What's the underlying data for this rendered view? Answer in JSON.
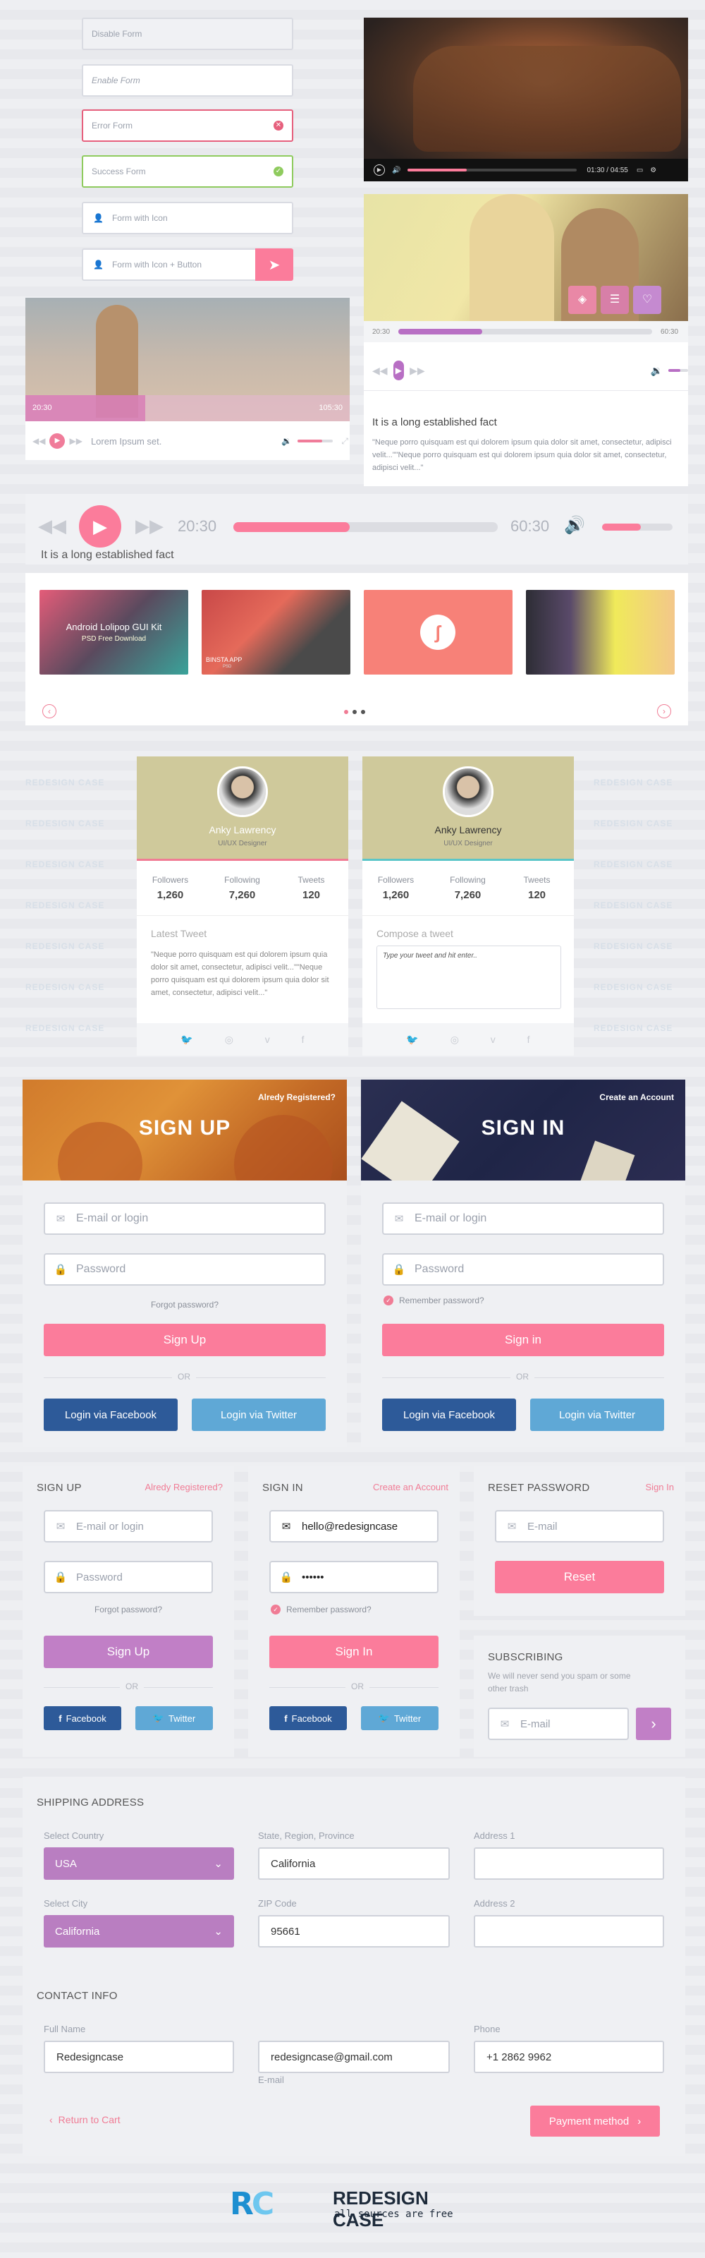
{
  "forms": {
    "disable": "Disable Form",
    "enable": "Enable Form",
    "error": "Error Form",
    "success": "Success Form",
    "with_icon": "Form with Icon",
    "with_icon_button": "Form with Icon + Button"
  },
  "video_player": {
    "time": "01:30 / 04:55"
  },
  "photo_player": {
    "current": "20:30",
    "total": "60:30",
    "title": "It is a long established fact",
    "text": "\"Neque porro quisquam est qui dolorem ipsum quia dolor sit amet, consectetur, adipisci velit...\"\"Neque porro quisquam est qui dolorem ipsum quia dolor sit amet, consectetur, adipisci velit...\"",
    "progress": 0.33,
    "volume": 0.6
  },
  "girl_player": {
    "current": "20:30",
    "total": "105:30",
    "title": "Lorem Ipsum set.",
    "progress": 0.37,
    "volume": 0.7
  },
  "big_player": {
    "current": "20:30",
    "total": "60:30",
    "title": "It is a long established fact",
    "progress": 0.44,
    "volume": 0.55
  },
  "gallery": {
    "items": [
      {
        "title": "Android Lolipop GUI Kit",
        "sub": "PSD Free Download"
      },
      {
        "title": "BINSTA APP",
        "sub": "PSD"
      },
      {
        "title": "",
        "sub": ""
      },
      {
        "title": "",
        "sub": ""
      }
    ]
  },
  "profiles": [
    {
      "name": "Anky Lawrency",
      "role": "UI/UX Designer",
      "stats": [
        {
          "label": "Followers",
          "value": "1,260"
        },
        {
          "label": "Following",
          "value": "7,260"
        },
        {
          "label": "Tweets",
          "value": "120"
        }
      ],
      "section": "Latest Tweet",
      "text": "\"Neque porro quisquam est qui dolorem ipsum quia dolor sit amet, consectetur, adipisci velit...\"\"Neque porro quisquam est qui dolorem ipsum quia dolor sit amet, consectetur, adipisci velit...\""
    },
    {
      "name": "Anky Lawrency",
      "role": "UI/UX Designer",
      "stats": [
        {
          "label": "Followers",
          "value": "1,260"
        },
        {
          "label": "Following",
          "value": "7,260"
        },
        {
          "label": "Tweets",
          "value": "120"
        }
      ],
      "section": "Compose a tweet",
      "placeholder": "Type your tweet and hit enter.."
    }
  ],
  "watermark": "REDESIGN CASE",
  "signup_big": {
    "title": "SIGN UP",
    "link": "Alredy Registered?",
    "email": "E-mail or login",
    "password": "Password",
    "forgot": "Forgot password?",
    "button": "Sign Up",
    "or": "OR",
    "facebook": "Login via Facebook",
    "twitter": "Login via Twitter"
  },
  "signin_big": {
    "title": "SIGN IN",
    "link": "Create an Account",
    "email": "E-mail or login",
    "password": "Password",
    "remember": "Remember password?",
    "button": "Sign in",
    "or": "OR",
    "facebook": "Login via Facebook",
    "twitter": "Login via Twitter"
  },
  "signup_small": {
    "title": "SIGN UP",
    "link": "Alredy Registered?",
    "email": "E-mail or login",
    "password": "Password",
    "forgot": "Forgot password?",
    "button": "Sign Up",
    "or": "OR",
    "facebook": "Facebook",
    "twitter": "Twitter"
  },
  "signin_small": {
    "title": "SIGN IN",
    "link": "Create an Account",
    "email": "hello@redesigncase",
    "password": "••••••",
    "remember": "Remember password?",
    "button": "Sign In",
    "or": "OR",
    "facebook": "Facebook",
    "twitter": "Twitter"
  },
  "reset": {
    "title": "RESET PASSWORD",
    "link": "Sign In",
    "email": "E-mail",
    "button": "Reset"
  },
  "subscribe": {
    "title": "SUBSCRIBING",
    "text": "We will never send you spam or some other trash",
    "email": "E-mail"
  },
  "shipping": {
    "title": "SHIPPING ADDRESS",
    "country_label": "Select Country",
    "country": "USA",
    "state_label": "State, Region, Province",
    "state": "California",
    "address1_label": "Address 1",
    "city_label": "Select City",
    "city": "California",
    "zip_label": "ZIP Code",
    "zip": "95661",
    "address2_label": "Address 2"
  },
  "contact": {
    "title": "CONTACT INFO",
    "name_label": "Full Name",
    "name": "Redesigncase",
    "email": "redesigncase@gmail.com",
    "email_label": "E-mail",
    "phone_label": "Phone",
    "phone": "+1 2862 9962",
    "back": "Return to Cart",
    "pay": "Payment method"
  },
  "logo": {
    "name": "REDESIGN CASE",
    "tagline": "all sources are free"
  },
  "colors": {
    "pink": "#fb7c9b",
    "purple": "#c17fc6",
    "facebook": "#2d5a99",
    "twitter": "#5fa8d6"
  }
}
